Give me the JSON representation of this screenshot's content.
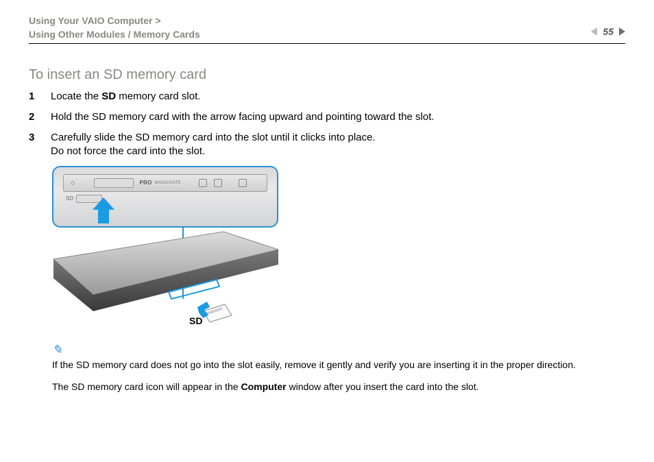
{
  "header": {
    "breadcrumb_top": "Using Your VAIO Computer",
    "breadcrumb_sep": ">",
    "breadcrumb_sub": "Using Other Modules / Memory Cards",
    "page_number": "55"
  },
  "title": "To insert an SD memory card",
  "steps": [
    {
      "num": "1",
      "html": "Locate the <b>SD</b> memory card slot."
    },
    {
      "num": "2",
      "html": "Hold the SD memory card with the arrow facing upward and pointing toward the slot."
    },
    {
      "num": "3",
      "html": "Carefully slide the SD memory card into the slot until it clicks into place.<br>Do not force the card into the slot."
    }
  ],
  "figure": {
    "strip_label": "PRO",
    "strip_sub": "MAGICGATE",
    "sd_small": "SD",
    "sd_label": "SD"
  },
  "notes": {
    "line1": "If the SD memory card does not go into the slot easily, remove it gently and verify you are inserting it in the proper direction.",
    "line2_pre": "The SD memory card icon will appear in the ",
    "line2_bold": "Computer",
    "line2_post": " window after you insert the card into the slot."
  }
}
